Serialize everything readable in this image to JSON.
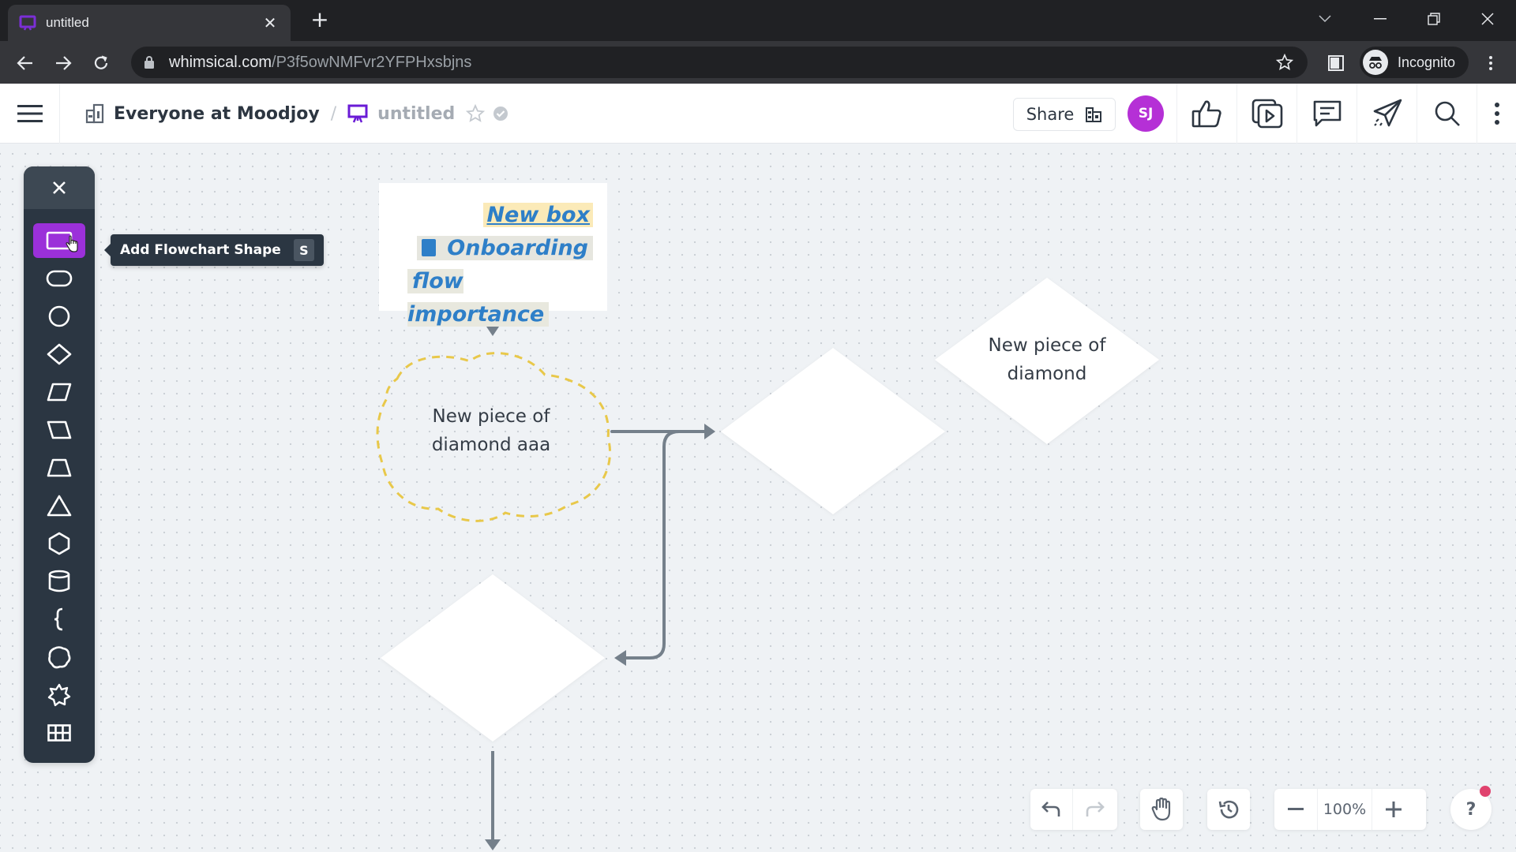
{
  "browser": {
    "tab_title": "untitled",
    "url_host": "whimsical.com",
    "url_path": "/P3f5owNMFvr2YFPHxsbjns",
    "profile_label": "Incognito"
  },
  "header": {
    "workspace": "Everyone at Moodjoy",
    "separator": "/",
    "doc_title": "untitled",
    "share_label": "Share",
    "avatar_initials": "SJ",
    "colors": {
      "avatar": "#b530d6",
      "doc_icon": "#6a1bd6"
    }
  },
  "shape_toolbar": {
    "tooltip_label": "Add Flowchart Shape",
    "tooltip_shortcut": "S",
    "items": [
      {
        "name": "rectangle",
        "active": true
      },
      {
        "name": "rounded-rectangle"
      },
      {
        "name": "circle"
      },
      {
        "name": "diamond"
      },
      {
        "name": "parallelogram"
      },
      {
        "name": "parallelogram-reverse"
      },
      {
        "name": "trapezoid"
      },
      {
        "name": "triangle"
      },
      {
        "name": "hexagon"
      },
      {
        "name": "cylinder"
      },
      {
        "name": "brace"
      },
      {
        "name": "cloud"
      },
      {
        "name": "star"
      },
      {
        "name": "table"
      }
    ]
  },
  "canvas": {
    "textbox": {
      "line1": "New box",
      "line2": "Onboarding",
      "line3": "flow importance"
    },
    "cloud_node": {
      "line1": "New piece of",
      "line2": "diamond aaa"
    },
    "diamond_top_right": {
      "line1": "New piece of",
      "line2": "diamond"
    }
  },
  "controls": {
    "zoom_level": "100%",
    "help_label": "?"
  }
}
